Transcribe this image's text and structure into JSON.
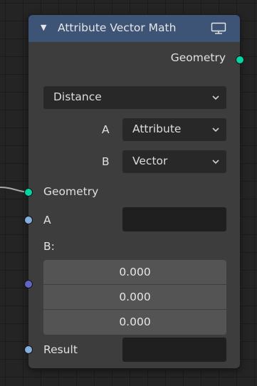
{
  "node": {
    "title": "Attribute Vector Math",
    "header_color": "#3d5477",
    "collapse_icon": "triangle-down-icon",
    "preview_icon": "monitor-icon",
    "output_label": "Geometry",
    "operation": "Distance",
    "input_a_type": "Attribute",
    "input_b_type": "Vector",
    "socket_geometry_label": "Geometry",
    "socket_a_label": "A",
    "socket_b_label": "B:",
    "vector_b": [
      "0.000",
      "0.000",
      "0.000"
    ],
    "result_label": "Result",
    "type_a_row_label": "A",
    "type_b_row_label": "B",
    "a_value": "",
    "result_value": ""
  },
  "colors": {
    "geometry_socket": "#00d6a3",
    "attribute_socket": "#84aede",
    "vector_socket": "#6363c7",
    "canvas_background": "#242424",
    "node_body": "#3d3d3d"
  }
}
